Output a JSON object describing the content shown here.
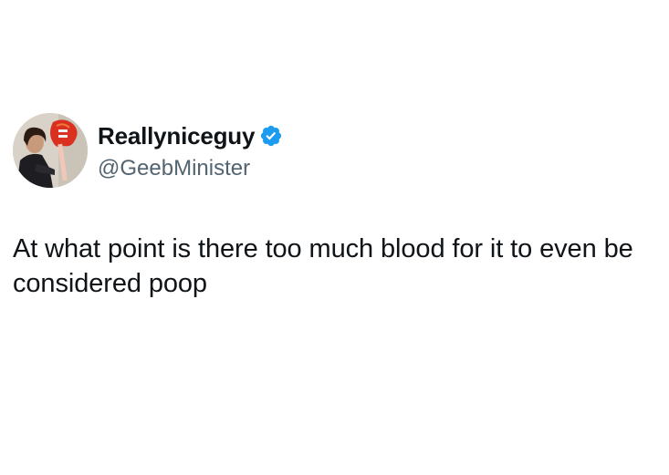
{
  "tweet": {
    "author": {
      "display_name": "Reallyniceguy",
      "handle": "@GeebMinister",
      "verified": true,
      "verified_color": "#1d9bf0",
      "avatar_icon": "profile-photo-person-with-red-guitar"
    },
    "text": "At what point is there too much blood for it to even be considered poop"
  },
  "colors": {
    "background": "#ffffff",
    "text_primary": "#0f1419",
    "text_secondary": "#536471",
    "accent": "#1d9bf0"
  }
}
